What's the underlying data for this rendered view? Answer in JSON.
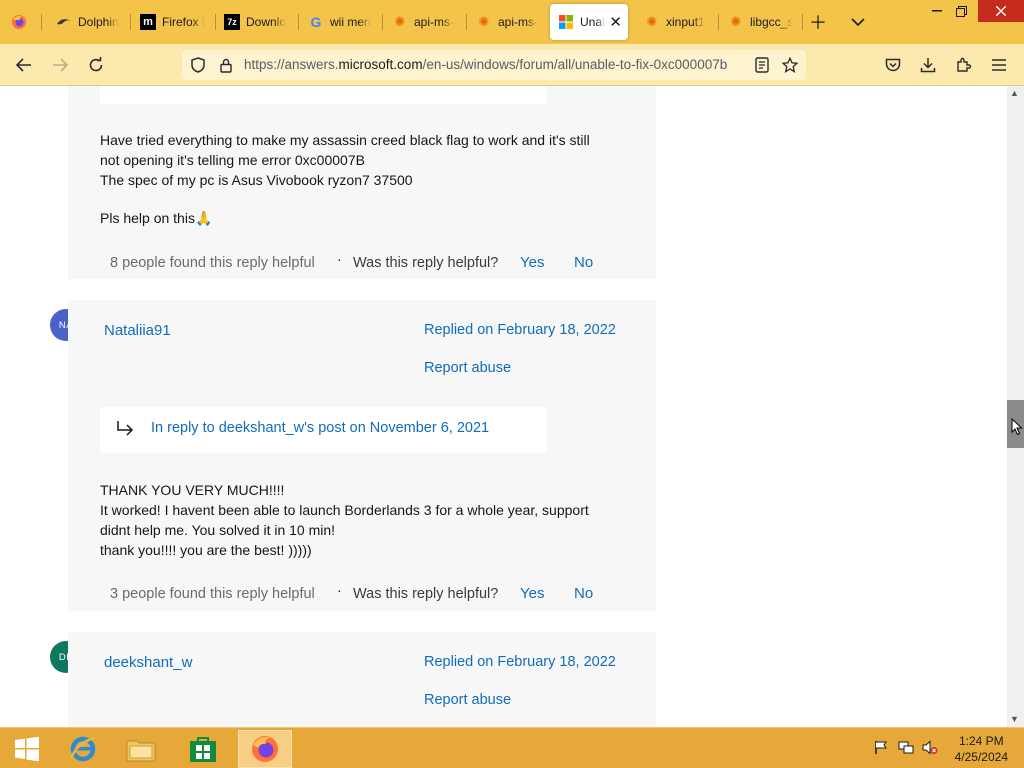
{
  "browser": {
    "tabs": [
      {
        "label": "Dolphin",
        "icon": "dolphin-icon"
      },
      {
        "label": "Firefox l",
        "icon": "mozilla-m-icon"
      },
      {
        "label": "Downlo",
        "icon": "7zip-icon"
      },
      {
        "label": "wii men",
        "icon": "google-g-icon"
      },
      {
        "label": "api-ms-",
        "icon": "gear-orange-icon"
      },
      {
        "label": "api-ms-",
        "icon": "gear-orange-icon"
      },
      {
        "label": "Unal",
        "icon": "microsoft-logo-icon",
        "active": true
      },
      {
        "label": "xinput1",
        "icon": "gear-orange-icon"
      },
      {
        "label": "libgcc_s",
        "icon": "gear-orange-icon"
      }
    ],
    "url_prefix": "https://answers.",
    "url_domain": "microsoft.com",
    "url_suffix": "/en-us/windows/forum/all/unable-to-fix-0xc000007b"
  },
  "post1": {
    "body_lines": [
      "Have tried everything to make my assassin creed black flag to work and it's still",
      "not opening it's telling me error 0xc00007B",
      "The spec of my pc is Asus Vivobook ryzon7 37500",
      "",
      "Pls help on this🙏"
    ],
    "helpful_count": "8 people found this reply helpful",
    "helpful_question": "Was this reply helpful?",
    "yes": "Yes",
    "no": "No"
  },
  "post2": {
    "avatar_initials": "NA",
    "avatar_color": "#4a62c7",
    "username": "Nataliia91",
    "replied": "Replied on February 18, 2022",
    "report": "Report abuse",
    "in_reply": "In reply to deekshant_w's post on November 6, 2021",
    "body_lines": [
      "THANK YOU VERY MUCH!!!!",
      "It worked! I havent been able to launch Borderlands 3 for a whole year, support",
      "didnt help me. You solved it in 10 min!",
      "thank you!!!! you are the best! )))))"
    ],
    "helpful_count": "3 people found this reply helpful",
    "helpful_question": "Was this reply helpful?",
    "yes": "Yes",
    "no": "No"
  },
  "post3": {
    "avatar_initials": "DE",
    "avatar_color": "#0d7a5f",
    "username": "deekshant_w",
    "replied": "Replied on February 18, 2022",
    "report": "Report abuse"
  },
  "taskbar": {
    "time": "1:24 PM",
    "date": "4/25/2024"
  }
}
